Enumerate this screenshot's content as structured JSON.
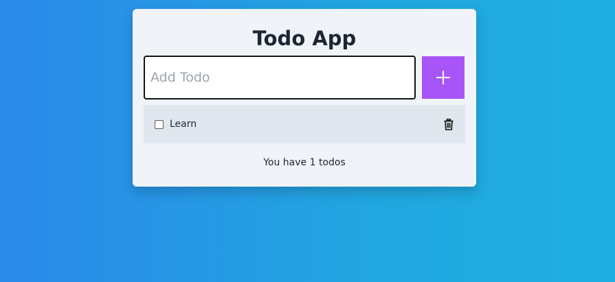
{
  "app": {
    "title": "Todo App"
  },
  "input": {
    "placeholder": "Add Todo",
    "value": ""
  },
  "add_button": {
    "icon": "plus-icon",
    "color": "#a855f7"
  },
  "todos": [
    {
      "label": "Learn",
      "checked": false,
      "delete_icon": "trash-icon"
    }
  ],
  "footer": {
    "status_text": "You have 1 todos"
  },
  "colors": {
    "card_background": "#f0f3f8",
    "item_background": "#e1e7ef",
    "page_gradient_start": "#2b89ea",
    "page_gradient_end": "#1fafe0"
  }
}
